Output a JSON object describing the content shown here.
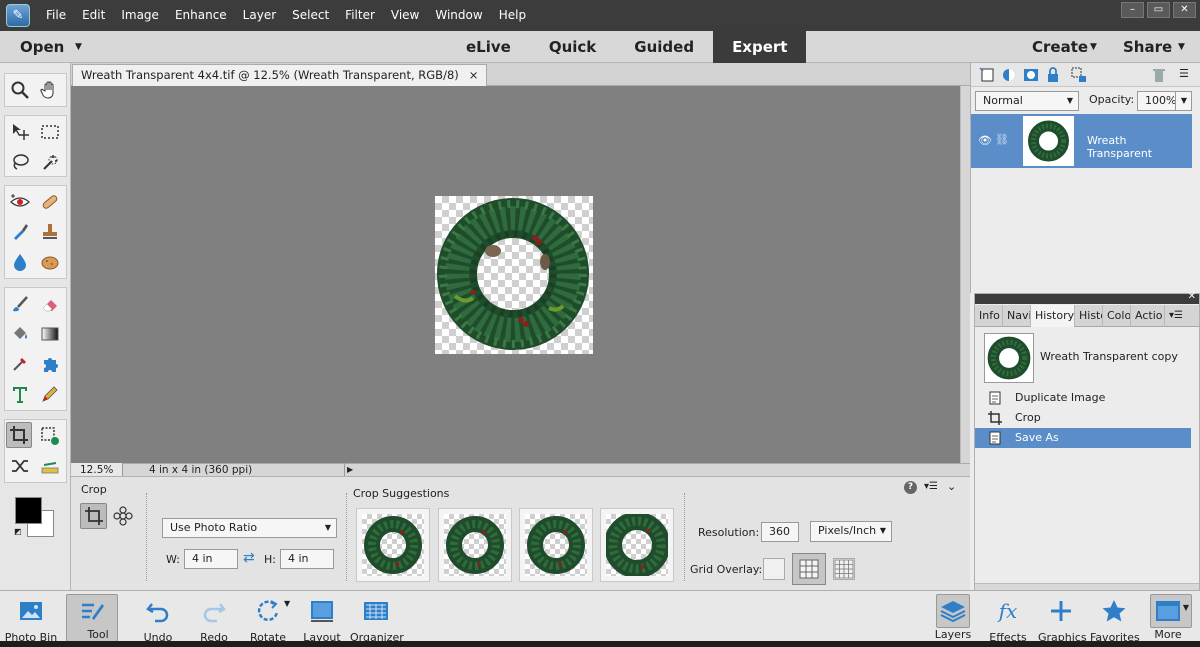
{
  "menubar": {
    "items": [
      "File",
      "Edit",
      "Image",
      "Enhance",
      "Layer",
      "Select",
      "Filter",
      "View",
      "Window",
      "Help"
    ],
    "window_controls": [
      "–",
      "▭",
      "✕"
    ]
  },
  "modebar": {
    "open": "Open",
    "modes": [
      "eLive",
      "Quick",
      "Guided",
      "Expert"
    ],
    "active_mode": "Expert",
    "create": "Create",
    "share": "Share"
  },
  "document": {
    "tab_title": "Wreath Transparent 4x4.tif @ 12.5% (Wreath Transparent, RGB/8)",
    "tab_close": "×",
    "zoom": "12.5%",
    "doc_info": "4 in x 4 in (360 ppi)"
  },
  "tool_options": {
    "tool_name": "Crop",
    "ratio": "Use Photo Ratio",
    "w_label": "W:",
    "w_value": "4 in",
    "h_label": "H:",
    "h_value": "4 in",
    "suggestions_label": "Crop Suggestions",
    "resolution_label": "Resolution:",
    "resolution_value": "360",
    "resolution_unit": "Pixels/Inch",
    "grid_overlay_label": "Grid Overlay:",
    "help": "?"
  },
  "layers": {
    "blend_mode": "Normal",
    "opacity_label": "Opacity:",
    "opacity_value": "100%",
    "layer_name": "Wreath Transparent"
  },
  "history": {
    "tabs": [
      "Info",
      "Navi",
      "History",
      "Histo",
      "Colo",
      "Actio"
    ],
    "active_tab": "History",
    "snapshot": "Wreath Transparent copy",
    "items": [
      "Duplicate Image",
      "Crop",
      "Save As"
    ],
    "selected_item": "Save As"
  },
  "bottombar": {
    "left": [
      "Photo Bin",
      "Tool Options",
      "Undo",
      "Redo",
      "Rotate",
      "Layout",
      "Organizer"
    ],
    "right": [
      "Layers",
      "Effects",
      "Graphics",
      "Favorites",
      "More"
    ]
  },
  "colors": {
    "selection_blue": "#5b8dc9",
    "canvas_gray": "#808080",
    "accent_icon_blue": "#2f7fc8"
  }
}
